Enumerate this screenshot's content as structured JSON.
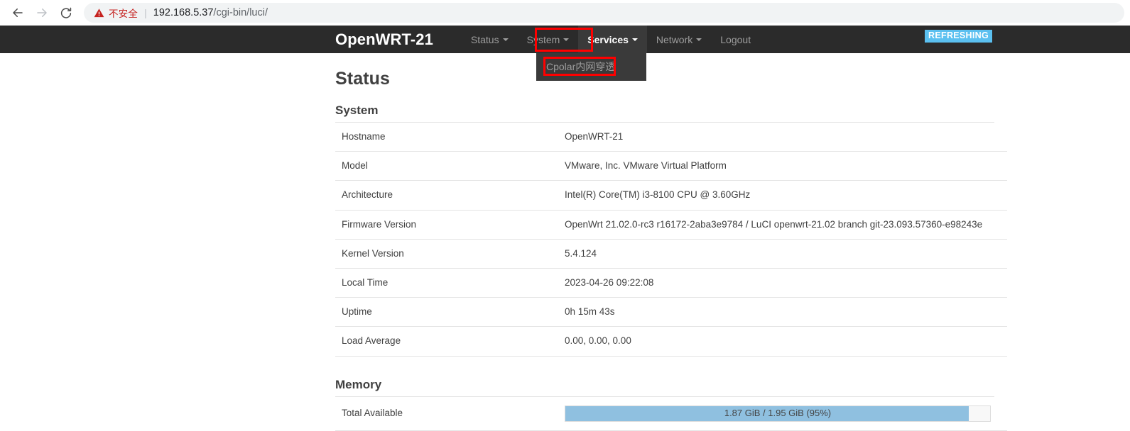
{
  "browser": {
    "back_icon": "back-arrow-icon",
    "forward_icon": "forward-arrow-icon",
    "reload_icon": "reload-icon",
    "security_warning_icon": "warning-triangle-icon",
    "security_label": "不安全",
    "url_host": "192.168.5.37",
    "url_path": "/cgi-bin/luci/",
    "separator": "|"
  },
  "nav": {
    "brand": "OpenWRT-21",
    "items": [
      {
        "label": "Status",
        "has_caret": true,
        "active": false
      },
      {
        "label": "System",
        "has_caret": true,
        "active": false
      },
      {
        "label": "Services",
        "has_caret": true,
        "active": true
      },
      {
        "label": "Network",
        "has_caret": true,
        "active": false
      },
      {
        "label": "Logout",
        "has_caret": false,
        "active": false
      }
    ],
    "dropdown": {
      "items": [
        {
          "label": "Cpolar内网穿透"
        }
      ]
    },
    "refresh_badge": "REFRESHING",
    "colors": {
      "navbar_bg": "#2b2b2b",
      "active_bg": "#3a3a3a",
      "dropdown_bg": "#3a3a3a",
      "badge_bg": "#5bc0f0",
      "annotation": "#ff0000"
    }
  },
  "page": {
    "title": "Status",
    "sections": [
      {
        "heading": "System",
        "rows": [
          {
            "label": "Hostname",
            "value": "OpenWRT-21"
          },
          {
            "label": "Model",
            "value": "VMware, Inc. VMware Virtual Platform"
          },
          {
            "label": "Architecture",
            "value": "Intel(R) Core(TM) i3-8100 CPU @ 3.60GHz"
          },
          {
            "label": "Firmware Version",
            "value": "OpenWrt 21.02.0-rc3 r16172-2aba3e9784 / LuCI openwrt-21.02 branch git-23.093.57360-e98243e"
          },
          {
            "label": "Kernel Version",
            "value": "5.4.124"
          },
          {
            "label": "Local Time",
            "value": "2023-04-26 09:22:08"
          },
          {
            "label": "Uptime",
            "value": "0h 15m 43s"
          },
          {
            "label": "Load Average",
            "value": "0.00, 0.00, 0.00"
          }
        ]
      },
      {
        "heading": "Memory",
        "rows": [
          {
            "label": "Total Available",
            "progress": {
              "text": "1.87 GiB / 1.95 GiB (95%)",
              "percent": 95,
              "fill_color": "#8fc0e0"
            }
          }
        ]
      }
    ]
  }
}
